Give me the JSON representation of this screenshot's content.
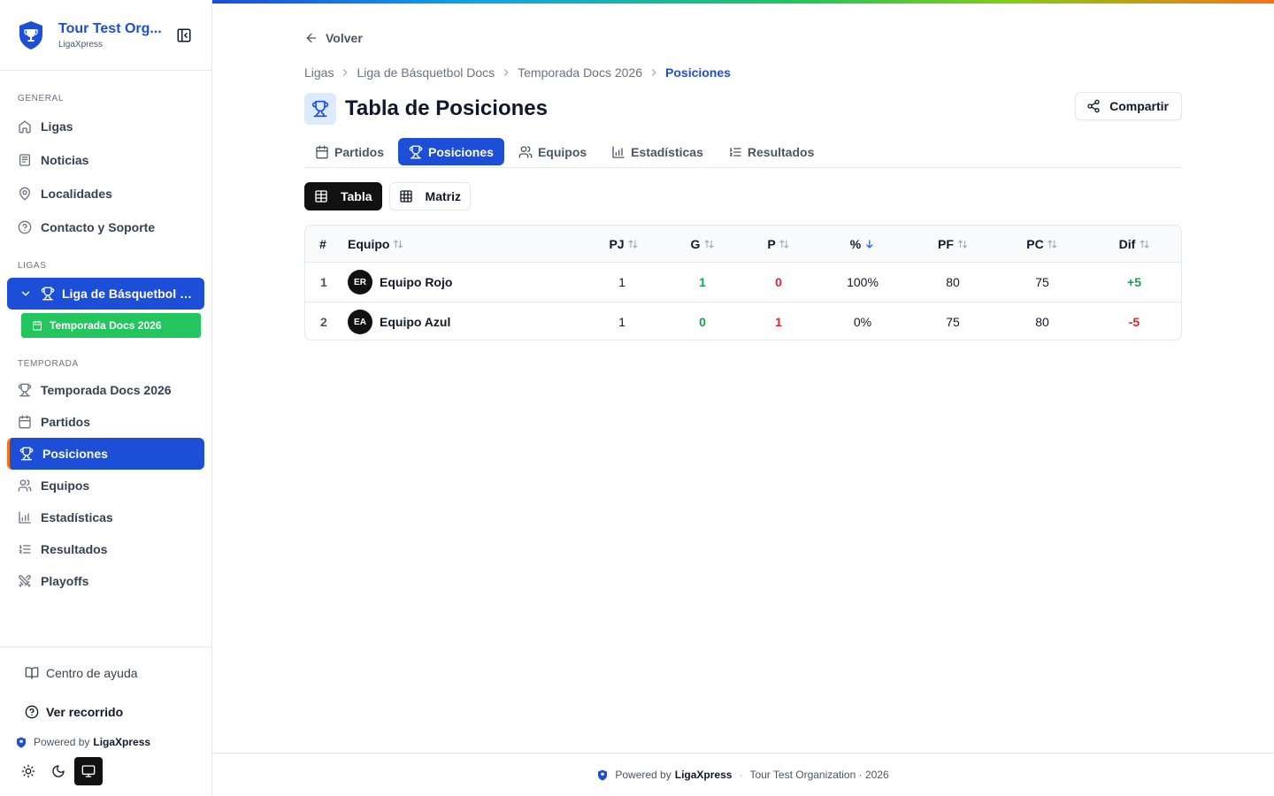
{
  "org": {
    "name": "Tour Test Org...",
    "subtitle": "LigaXpress"
  },
  "sidebar": {
    "general_label": "GENERAL",
    "general_items": [
      {
        "label": "Ligas",
        "icon": "home-icon"
      },
      {
        "label": "Noticias",
        "icon": "newspaper-icon"
      },
      {
        "label": "Localidades",
        "icon": "map-pin-icon"
      },
      {
        "label": "Contacto y Soporte",
        "icon": "help-circle-icon"
      }
    ],
    "ligas_label": "LIGAS",
    "league": "Liga de Básquetbol D...",
    "season": "Temporada Docs 2026",
    "temporada_label": "TEMPORADA",
    "temporada_items": [
      {
        "label": "Temporada Docs 2026",
        "icon": "trophy-icon"
      },
      {
        "label": "Partidos",
        "icon": "calendar-icon"
      },
      {
        "label": "Posiciones",
        "icon": "trophy-icon",
        "active": true
      },
      {
        "label": "Equipos",
        "icon": "users-icon"
      },
      {
        "label": "Estadísticas",
        "icon": "bar-chart-icon"
      },
      {
        "label": "Resultados",
        "icon": "list-ordered-icon"
      },
      {
        "label": "Playoffs",
        "icon": "swords-icon"
      }
    ],
    "help": "Centro de ayuda",
    "tour": "Ver recorrido",
    "powered_prefix": "Powered by",
    "powered_brand": "LigaXpress"
  },
  "main": {
    "back": "Volver",
    "breadcrumbs": [
      "Ligas",
      "Liga de Básquetbol Docs",
      "Temporada Docs 2026",
      "Posiciones"
    ],
    "title": "Tabla de Posiciones",
    "share": "Compartir",
    "tabs": [
      "Partidos",
      "Posiciones",
      "Equipos",
      "Estadísticas",
      "Resultados"
    ],
    "active_tab": "Posiciones",
    "views": [
      "Tabla",
      "Matriz"
    ],
    "active_view": "Tabla"
  },
  "table": {
    "headers": [
      "#",
      "Equipo",
      "PJ",
      "G",
      "P",
      "%",
      "PF",
      "PC",
      "Dif"
    ],
    "sorted_by": "%",
    "rows": [
      {
        "rank": "1",
        "initials": "ER",
        "team": "Equipo Rojo",
        "pj": "1",
        "g": "1",
        "p": "0",
        "pct": "100%",
        "pf": "80",
        "pc": "75",
        "dif": "+5"
      },
      {
        "rank": "2",
        "initials": "EA",
        "team": "Equipo Azul",
        "pj": "1",
        "g": "0",
        "p": "1",
        "pct": "0%",
        "pf": "75",
        "pc": "80",
        "dif": "-5"
      }
    ]
  },
  "footer": {
    "powered_prefix": "Powered by",
    "brand": "LigaXpress",
    "rest": "Tour Test Organization · 2026"
  },
  "colors": {
    "primary": "#1d4ed8",
    "season": "#22c55e",
    "positive": "#16a34a",
    "negative": "#dc2626"
  }
}
